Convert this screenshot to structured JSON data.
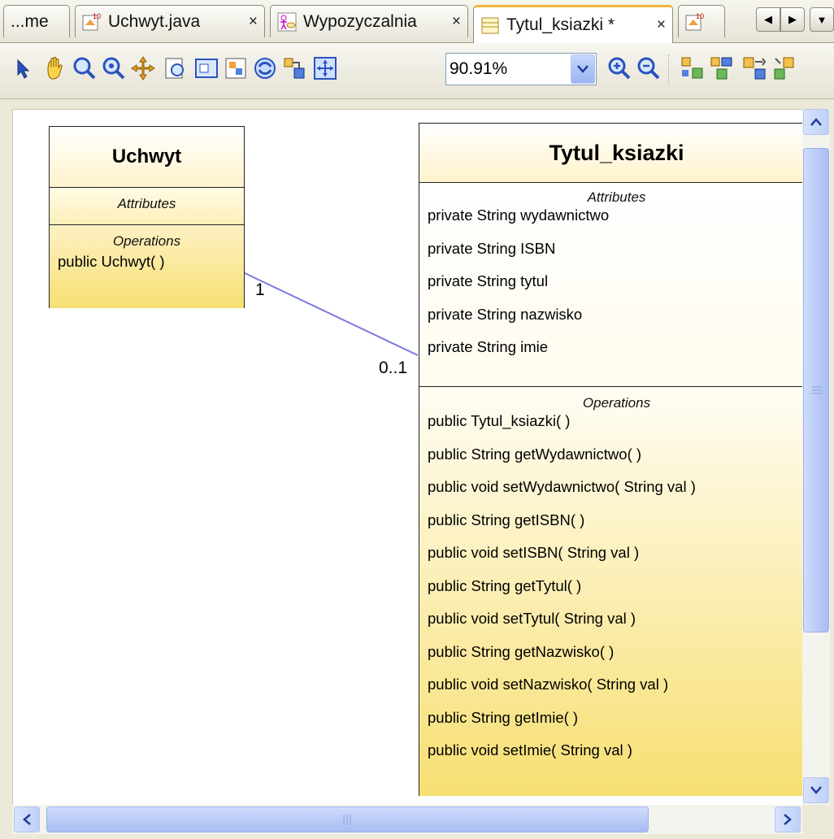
{
  "tabs": [
    {
      "label": "...me",
      "closable": false
    },
    {
      "label": "Uchwyt.java",
      "close": "×"
    },
    {
      "label": "Wypozyczalnia",
      "close": "×"
    },
    {
      "label": "Tytul_ksiazki *",
      "close": "×",
      "active": true
    },
    {
      "label": "",
      "close": ""
    }
  ],
  "tab_nav": {
    "prev": "◀",
    "next": "▶",
    "menu": "▼"
  },
  "toolbar": {
    "zoom_value": "90.91%",
    "buttons": [
      "select-icon",
      "pan-icon",
      "zoom-icon",
      "zoom-interactive-icon",
      "navigate-icon",
      "overview-icon",
      "fit-to-window-icon",
      "relayout-icon",
      "orthogonal-icon",
      "hierarchical-icon",
      "fit-icon",
      "zoom-in-icon",
      "zoom-out-icon",
      "layout-1-icon",
      "layout-2-icon",
      "layout-3-icon",
      "layout-4-icon"
    ]
  },
  "diagram": {
    "uchwyt": {
      "name": "Uchwyt",
      "attributes_title": "Attributes",
      "operations_title": "Operations",
      "operations": [
        "public Uchwyt(  )"
      ]
    },
    "tytul": {
      "name": "Tytul_ksiazki",
      "attributes_title": "Attributes",
      "attributes": [
        "private String wydawnictwo",
        "private String ISBN",
        "private String tytul",
        "private String nazwisko",
        "private String imie"
      ],
      "operations_title": "Operations",
      "operations": [
        "public Tytul_ksiazki(  )",
        "public String  getWydawnictwo(  )",
        "public void  setWydawnictwo( String val )",
        "public String  getISBN(  )",
        "public void  setISBN( String val )",
        "public String  getTytul(  )",
        "public void  setTytul( String val )",
        "public String  getNazwisko(  )",
        "public void  setNazwisko( String val )",
        "public String  getImie(  )",
        "public void  setImie( String val )"
      ]
    },
    "association": {
      "source_multiplicity": "1",
      "target_multiplicity": "0..1",
      "color": "#7b7be0"
    }
  },
  "colors": {
    "yellow_top": "#fff3cc",
    "yellow_bottom": "#f7df72",
    "accent": "#f0b440"
  }
}
